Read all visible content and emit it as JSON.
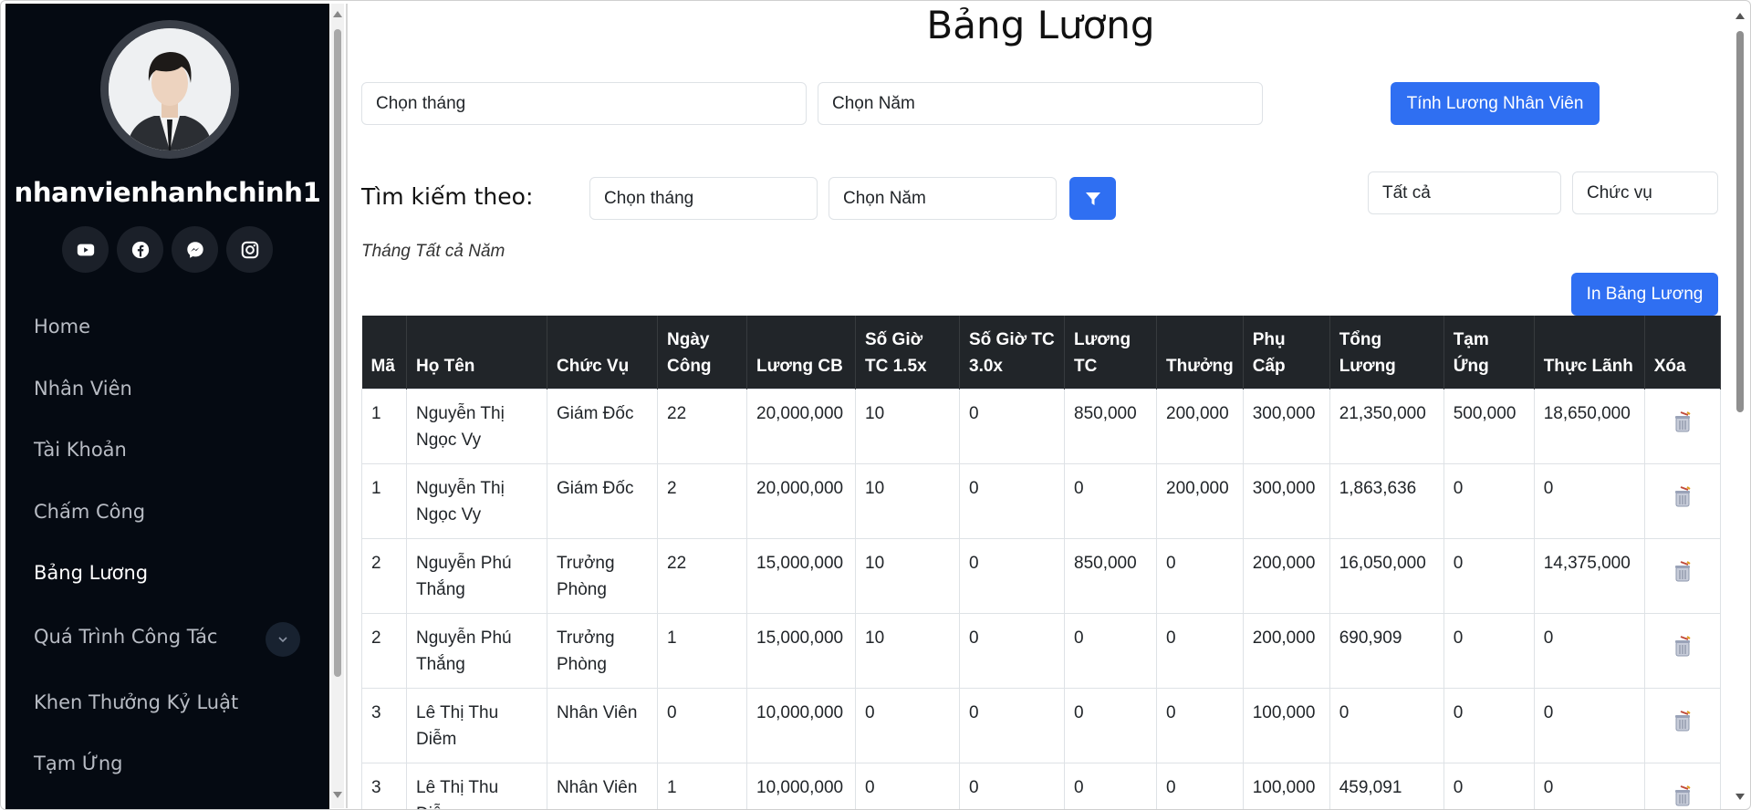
{
  "sidebar": {
    "username": "nhanvienhanhchinh1",
    "socials": [
      "youtube-icon",
      "facebook-icon",
      "messenger-icon",
      "instagram-icon"
    ],
    "menu": [
      {
        "label": "Home"
      },
      {
        "label": "Nhân Viên"
      },
      {
        "label": "Tài Khoản"
      },
      {
        "label": "Chấm Công"
      },
      {
        "label": "Bảng Lương",
        "active": true
      },
      {
        "label": "Quá Trình Công Tác",
        "has_submenu": true
      },
      {
        "label": "Khen Thưởng Kỷ Luật"
      },
      {
        "label": "Tạm Ứng"
      }
    ]
  },
  "page": {
    "title": "Bảng Lương",
    "calc": {
      "month_placeholder": "Chọn tháng",
      "year_placeholder": "Chọn Năm",
      "button": "Tính Lương Nhân Viên"
    },
    "search": {
      "label": "Tìm kiếm theo:",
      "month_placeholder": "Chọn tháng",
      "year_placeholder": "Chọn Năm",
      "filter_icon": "filter-icon",
      "all_select": "Tất cả",
      "position_select": "Chức vụ"
    },
    "month_caption": "Tháng Tất cả Năm",
    "print_button": "In Bảng Lương"
  },
  "colors": {
    "sidebar_bg": "#050a12",
    "accent": "#2f6ff2",
    "table_header_bg": "#212529"
  },
  "table": {
    "headers": [
      "Mã",
      "Họ Tên",
      "Chức Vụ",
      "Ngày Công",
      "Lương CB",
      "Số Giờ TC 1.5x",
      "Số Giờ TC 3.0x",
      "Lương TC",
      "Thưởng",
      "Phụ Cấp",
      "Tổng Lương",
      "Tạm Ứng",
      "Thực Lãnh",
      "Xóa"
    ],
    "rows": [
      [
        "1",
        "Nguyễn Thị Ngọc Vy",
        "Giám Đốc",
        "22",
        "20,000,000",
        "10",
        "0",
        "850,000",
        "200,000",
        "300,000",
        "21,350,000",
        "500,000",
        "18,650,000"
      ],
      [
        "1",
        "Nguyễn Thị Ngọc Vy",
        "Giám Đốc",
        "2",
        "20,000,000",
        "10",
        "0",
        "0",
        "200,000",
        "300,000",
        "1,863,636",
        "0",
        "0"
      ],
      [
        "2",
        "Nguyễn Phú Thắng",
        "Trưởng Phòng",
        "22",
        "15,000,000",
        "10",
        "0",
        "850,000",
        "0",
        "200,000",
        "16,050,000",
        "0",
        "14,375,000"
      ],
      [
        "2",
        "Nguyễn Phú Thắng",
        "Trưởng Phòng",
        "1",
        "15,000,000",
        "10",
        "0",
        "0",
        "0",
        "200,000",
        "690,909",
        "0",
        "0"
      ],
      [
        "3",
        "Lê Thị Thu Diễm",
        "Nhân Viên",
        "0",
        "10,000,000",
        "0",
        "0",
        "0",
        "0",
        "100,000",
        "0",
        "0",
        "0"
      ],
      [
        "3",
        "Lê Thị Thu Diễm",
        "Nhân Viên",
        "1",
        "10,000,000",
        "0",
        "0",
        "0",
        "0",
        "100,000",
        "459,091",
        "0",
        "0"
      ]
    ]
  }
}
